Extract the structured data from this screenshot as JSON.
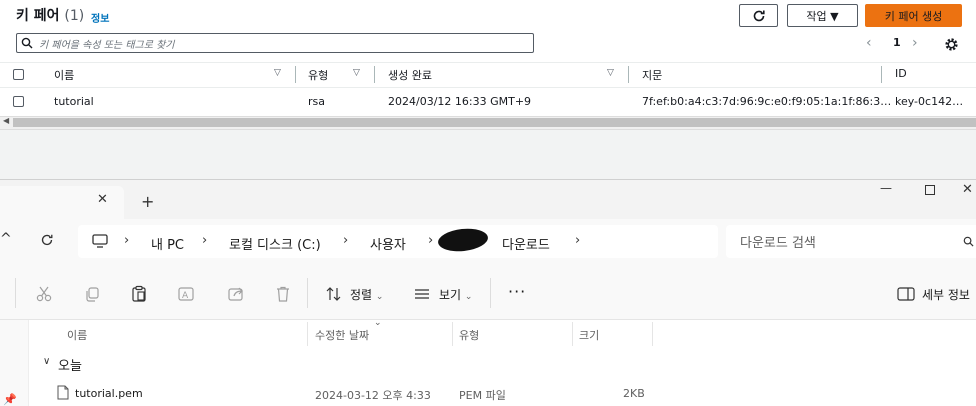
{
  "aws": {
    "title": "키 페어",
    "count": "(1)",
    "info_link": "정보",
    "actions_label": "작업 ▼",
    "create_label": "키 페어 생성",
    "search_placeholder": "키 페어을 속성 또는 태그로 찾기",
    "pagination": {
      "prev": "‹",
      "page": "1",
      "next": "›"
    },
    "columns": [
      "이름",
      "유형",
      "생성 완료",
      "지문",
      "ID"
    ],
    "rows": [
      {
        "name": "tutorial",
        "type": "rsa",
        "created": "2024/03/12 16:33 GMT+9",
        "fingerprint": "7f:ef:b0:a4:c3:7d:96:9c:e0:f9:05:1a:1f:86:3…",
        "id": "key-0c142…"
      }
    ],
    "accent_color": "#ec7211",
    "link_color": "#0073bb"
  },
  "explorer": {
    "tab_close": "✕",
    "tab_new": "+",
    "window_controls": {
      "minimize": "—",
      "close": "✕"
    },
    "breadcrumbs": [
      "내 PC",
      "로컬 디스크 (C:)",
      "사용자",
      "다운로드"
    ],
    "search_placeholder": "다운로드 검색",
    "toolbar": {
      "sort_label": "정렬",
      "view_label": "보기",
      "more": "···",
      "details_label": "세부 정보"
    },
    "columns": [
      "이름",
      "수정한 날짜",
      "유형",
      "크기"
    ],
    "group": "오늘",
    "files": [
      {
        "name": "tutorial.pem",
        "modified": "2024-03-12 오후 4:33",
        "type": "PEM 파일",
        "size": "2KB"
      }
    ]
  }
}
